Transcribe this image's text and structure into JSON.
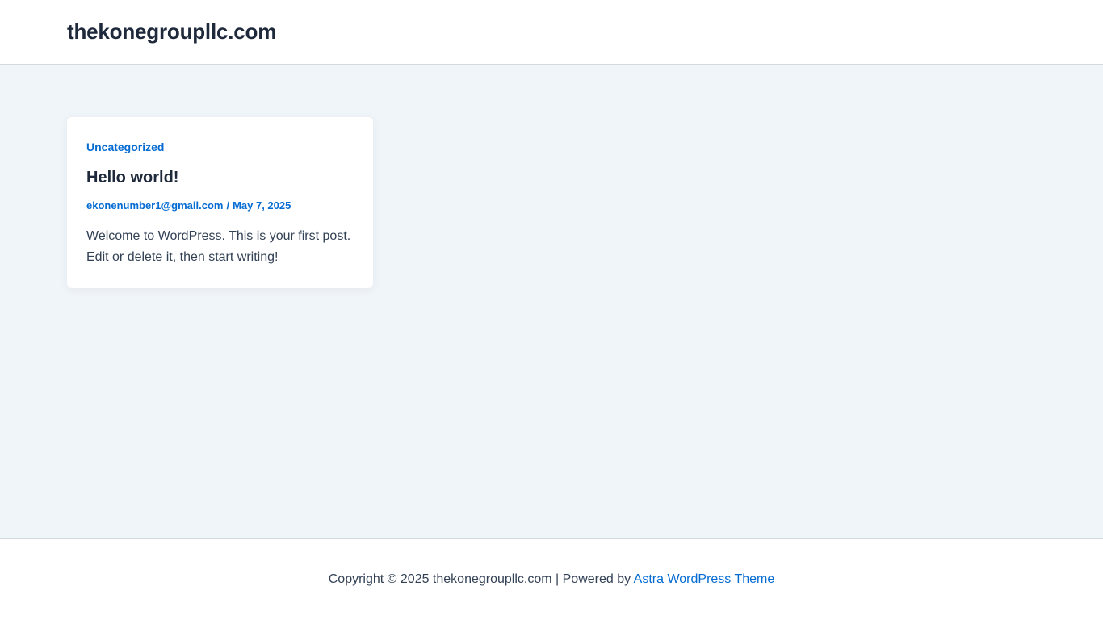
{
  "header": {
    "site_title": "thekonegroupllc.com"
  },
  "post": {
    "category": "Uncategorized",
    "title": "Hello world!",
    "author": "ekonenumber1@gmail.com",
    "meta_separator": "/",
    "date": "May 7, 2025",
    "excerpt": "Welcome to WordPress. This is your first post. Edit or delete it, then start writing!"
  },
  "footer": {
    "copyright_text": "Copyright © 2025 thekonegroupllc.com | Powered by",
    "theme_link": "Astra WordPress Theme"
  },
  "colors": {
    "accent": "#046bd2",
    "heading": "#1e293b",
    "body_text": "#334155",
    "page_background": "#f0f5fa",
    "surface": "#ffffff"
  }
}
